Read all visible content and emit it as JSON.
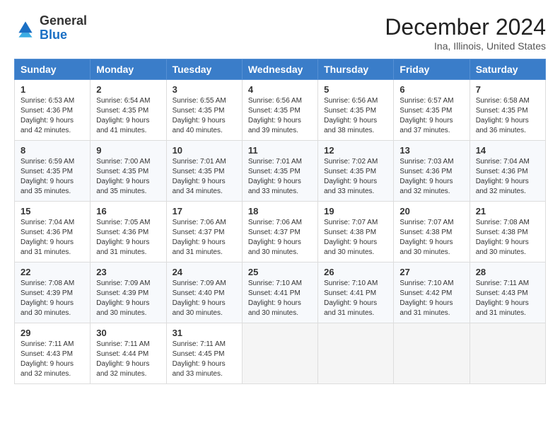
{
  "header": {
    "logo_general": "General",
    "logo_blue": "Blue",
    "month_year": "December 2024",
    "location": "Ina, Illinois, United States"
  },
  "weekdays": [
    "Sunday",
    "Monday",
    "Tuesday",
    "Wednesday",
    "Thursday",
    "Friday",
    "Saturday"
  ],
  "weeks": [
    [
      {
        "day": "1",
        "sunrise": "6:53 AM",
        "sunset": "4:36 PM",
        "daylight": "9 hours and 42 minutes."
      },
      {
        "day": "2",
        "sunrise": "6:54 AM",
        "sunset": "4:35 PM",
        "daylight": "9 hours and 41 minutes."
      },
      {
        "day": "3",
        "sunrise": "6:55 AM",
        "sunset": "4:35 PM",
        "daylight": "9 hours and 40 minutes."
      },
      {
        "day": "4",
        "sunrise": "6:56 AM",
        "sunset": "4:35 PM",
        "daylight": "9 hours and 39 minutes."
      },
      {
        "day": "5",
        "sunrise": "6:56 AM",
        "sunset": "4:35 PM",
        "daylight": "9 hours and 38 minutes."
      },
      {
        "day": "6",
        "sunrise": "6:57 AM",
        "sunset": "4:35 PM",
        "daylight": "9 hours and 37 minutes."
      },
      {
        "day": "7",
        "sunrise": "6:58 AM",
        "sunset": "4:35 PM",
        "daylight": "9 hours and 36 minutes."
      }
    ],
    [
      {
        "day": "8",
        "sunrise": "6:59 AM",
        "sunset": "4:35 PM",
        "daylight": "9 hours and 35 minutes."
      },
      {
        "day": "9",
        "sunrise": "7:00 AM",
        "sunset": "4:35 PM",
        "daylight": "9 hours and 35 minutes."
      },
      {
        "day": "10",
        "sunrise": "7:01 AM",
        "sunset": "4:35 PM",
        "daylight": "9 hours and 34 minutes."
      },
      {
        "day": "11",
        "sunrise": "7:01 AM",
        "sunset": "4:35 PM",
        "daylight": "9 hours and 33 minutes."
      },
      {
        "day": "12",
        "sunrise": "7:02 AM",
        "sunset": "4:35 PM",
        "daylight": "9 hours and 33 minutes."
      },
      {
        "day": "13",
        "sunrise": "7:03 AM",
        "sunset": "4:36 PM",
        "daylight": "9 hours and 32 minutes."
      },
      {
        "day": "14",
        "sunrise": "7:04 AM",
        "sunset": "4:36 PM",
        "daylight": "9 hours and 32 minutes."
      }
    ],
    [
      {
        "day": "15",
        "sunrise": "7:04 AM",
        "sunset": "4:36 PM",
        "daylight": "9 hours and 31 minutes."
      },
      {
        "day": "16",
        "sunrise": "7:05 AM",
        "sunset": "4:36 PM",
        "daylight": "9 hours and 31 minutes."
      },
      {
        "day": "17",
        "sunrise": "7:06 AM",
        "sunset": "4:37 PM",
        "daylight": "9 hours and 31 minutes."
      },
      {
        "day": "18",
        "sunrise": "7:06 AM",
        "sunset": "4:37 PM",
        "daylight": "9 hours and 30 minutes."
      },
      {
        "day": "19",
        "sunrise": "7:07 AM",
        "sunset": "4:38 PM",
        "daylight": "9 hours and 30 minutes."
      },
      {
        "day": "20",
        "sunrise": "7:07 AM",
        "sunset": "4:38 PM",
        "daylight": "9 hours and 30 minutes."
      },
      {
        "day": "21",
        "sunrise": "7:08 AM",
        "sunset": "4:38 PM",
        "daylight": "9 hours and 30 minutes."
      }
    ],
    [
      {
        "day": "22",
        "sunrise": "7:08 AM",
        "sunset": "4:39 PM",
        "daylight": "9 hours and 30 minutes."
      },
      {
        "day": "23",
        "sunrise": "7:09 AM",
        "sunset": "4:39 PM",
        "daylight": "9 hours and 30 minutes."
      },
      {
        "day": "24",
        "sunrise": "7:09 AM",
        "sunset": "4:40 PM",
        "daylight": "9 hours and 30 minutes."
      },
      {
        "day": "25",
        "sunrise": "7:10 AM",
        "sunset": "4:41 PM",
        "daylight": "9 hours and 30 minutes."
      },
      {
        "day": "26",
        "sunrise": "7:10 AM",
        "sunset": "4:41 PM",
        "daylight": "9 hours and 31 minutes."
      },
      {
        "day": "27",
        "sunrise": "7:10 AM",
        "sunset": "4:42 PM",
        "daylight": "9 hours and 31 minutes."
      },
      {
        "day": "28",
        "sunrise": "7:11 AM",
        "sunset": "4:43 PM",
        "daylight": "9 hours and 31 minutes."
      }
    ],
    [
      {
        "day": "29",
        "sunrise": "7:11 AM",
        "sunset": "4:43 PM",
        "daylight": "9 hours and 32 minutes."
      },
      {
        "day": "30",
        "sunrise": "7:11 AM",
        "sunset": "4:44 PM",
        "daylight": "9 hours and 32 minutes."
      },
      {
        "day": "31",
        "sunrise": "7:11 AM",
        "sunset": "4:45 PM",
        "daylight": "9 hours and 33 minutes."
      },
      null,
      null,
      null,
      null
    ]
  ]
}
